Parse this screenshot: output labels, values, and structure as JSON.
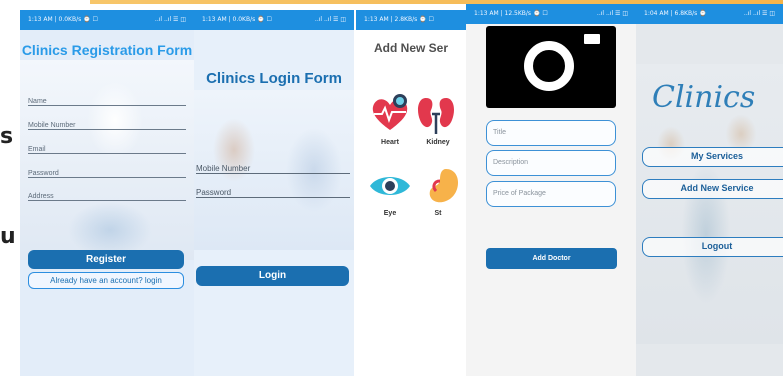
{
  "cut_text": [
    "s",
    "u"
  ],
  "status_bars": {
    "p1": "1:13 AM | 0.0KB/s ⌚ ☐",
    "p2": "1:13 AM | 0.0KB/s ⌚ ☐",
    "p3": "1:13 AM | 2.8KB/s ⌚ ☐",
    "p4": "1:13 AM | 12.5KB/s ⌚ ☐",
    "p5": "1:04 AM | 6.8KB/s ⌚",
    "signal": "..ıl ..ıl ☰ ◫"
  },
  "registration": {
    "title": "Clinics Registration Form",
    "fields": [
      "Name",
      "Mobile Number",
      "Email",
      "Password",
      "Address"
    ],
    "register_label": "Register",
    "login_link_label": "Already have an account? login"
  },
  "login": {
    "title": "Clinics Login Form",
    "mobile_label": "Mobile Number",
    "password_label": "Password",
    "login_label": "Login"
  },
  "add_service": {
    "title": "Add New Ser",
    "tiles": [
      {
        "label": "Heart",
        "icon": "heart-icon"
      },
      {
        "label": "Kidney",
        "icon": "kidney-icon"
      },
      {
        "label": "Eye",
        "icon": "eye-icon"
      },
      {
        "label": "St",
        "icon": "stomach-icon"
      }
    ]
  },
  "add_doctor": {
    "camera_icon": "camera-icon",
    "title_placeholder": "Title",
    "description_placeholder": "Description",
    "price_placeholder": "Price of Package",
    "add_label": "Add Doctor"
  },
  "home": {
    "logo": "Clinics",
    "buttons": [
      "My Services",
      "Add New Service",
      "Logout"
    ]
  },
  "colors": {
    "primary": "#1b6fb0",
    "accent": "#2a9be8",
    "status_bar": "#1e8fe0"
  }
}
